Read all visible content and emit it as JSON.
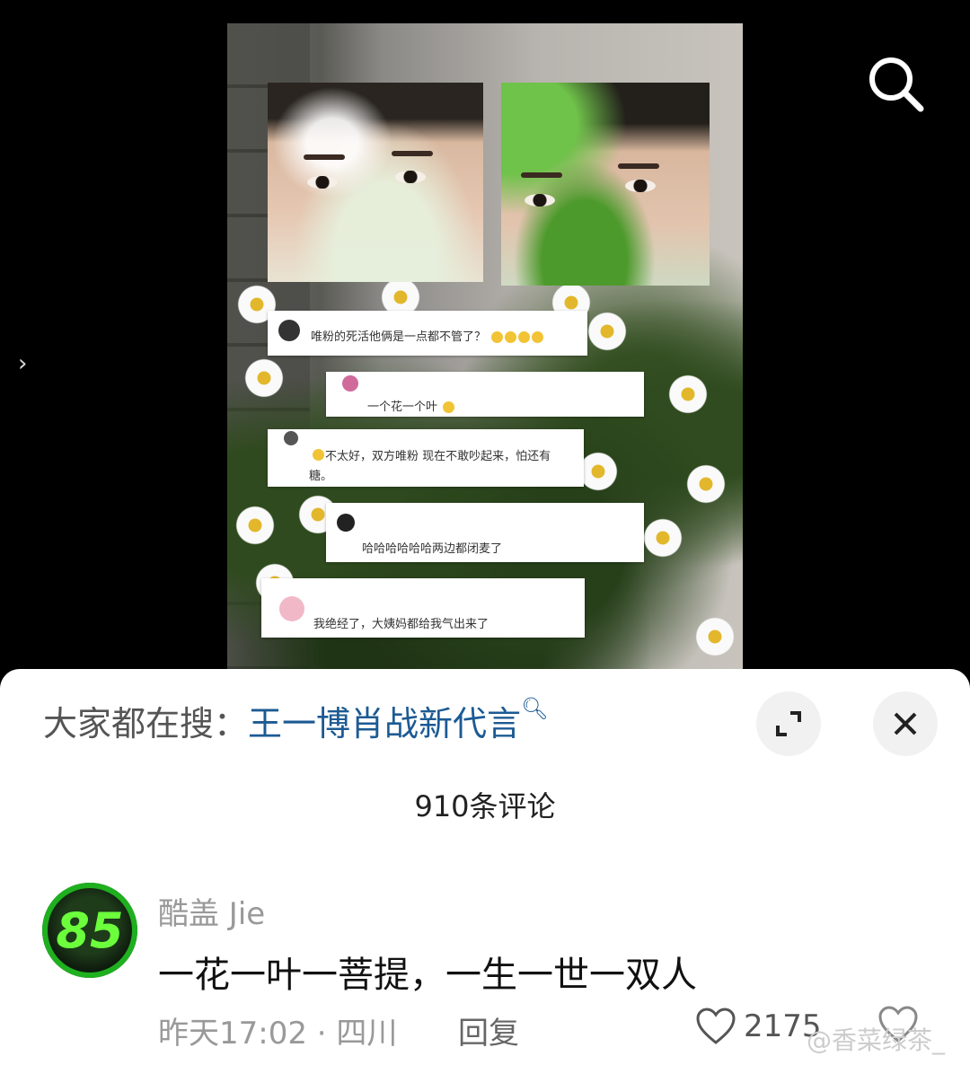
{
  "media": {
    "comments": [
      {
        "text": "唯粉的死活他俩是一点都不管了？"
      },
      {
        "text": "一个花一个叶"
      },
      {
        "text": "不太好，双方唯粉 现在不敢吵起来，怕还有糖。"
      },
      {
        "text": "哈哈哈哈哈哈两边都闭麦了"
      },
      {
        "text": "我绝经了，大姨妈都给我气出来了"
      }
    ]
  },
  "sheet": {
    "hot_search_label": "大家都在搜：",
    "hot_search_term": "王一博肖战新代言",
    "comment_count": "910条评论"
  },
  "comment": {
    "avatar_text": "85",
    "username": "酷盖 Jie",
    "text": "一花一叶一菩提，一生一世一双人",
    "time_location": "昨天17:02 · 四川",
    "reply_label": "回复",
    "like_count": "2175"
  },
  "watermark": "@香菜绿茶_",
  "colors": {
    "accent": "#1c5a93",
    "avatar_ring": "#1fb01f"
  }
}
